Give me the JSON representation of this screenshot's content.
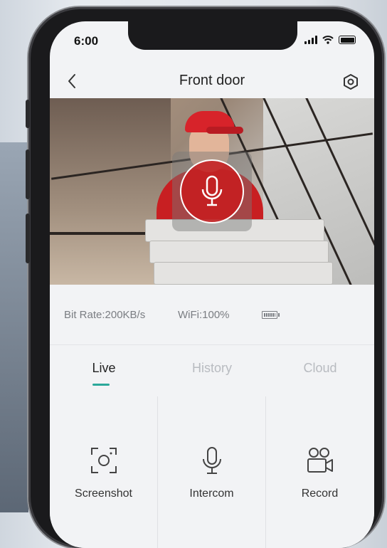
{
  "status_bar": {
    "time": "6:00"
  },
  "header": {
    "title": "Front door"
  },
  "video": {
    "overlay": "microphone-talk"
  },
  "info": {
    "bit_rate": "Bit Rate:200KB/s",
    "wifi": "WiFi:100%"
  },
  "tabs": [
    {
      "label": "Live",
      "active": true
    },
    {
      "label": "History",
      "active": false
    },
    {
      "label": "Cloud",
      "active": false
    }
  ],
  "actions": [
    {
      "label": "Screenshot",
      "icon": "screenshot-icon"
    },
    {
      "label": "Intercom",
      "icon": "microphone-icon"
    },
    {
      "label": "Record",
      "icon": "video-record-icon"
    }
  ],
  "colors": {
    "accent": "#2ba89a",
    "active_tab_text": "#222222",
    "inactive_tab_text": "#b8bbc0",
    "mic_button": "#c81c1e"
  }
}
